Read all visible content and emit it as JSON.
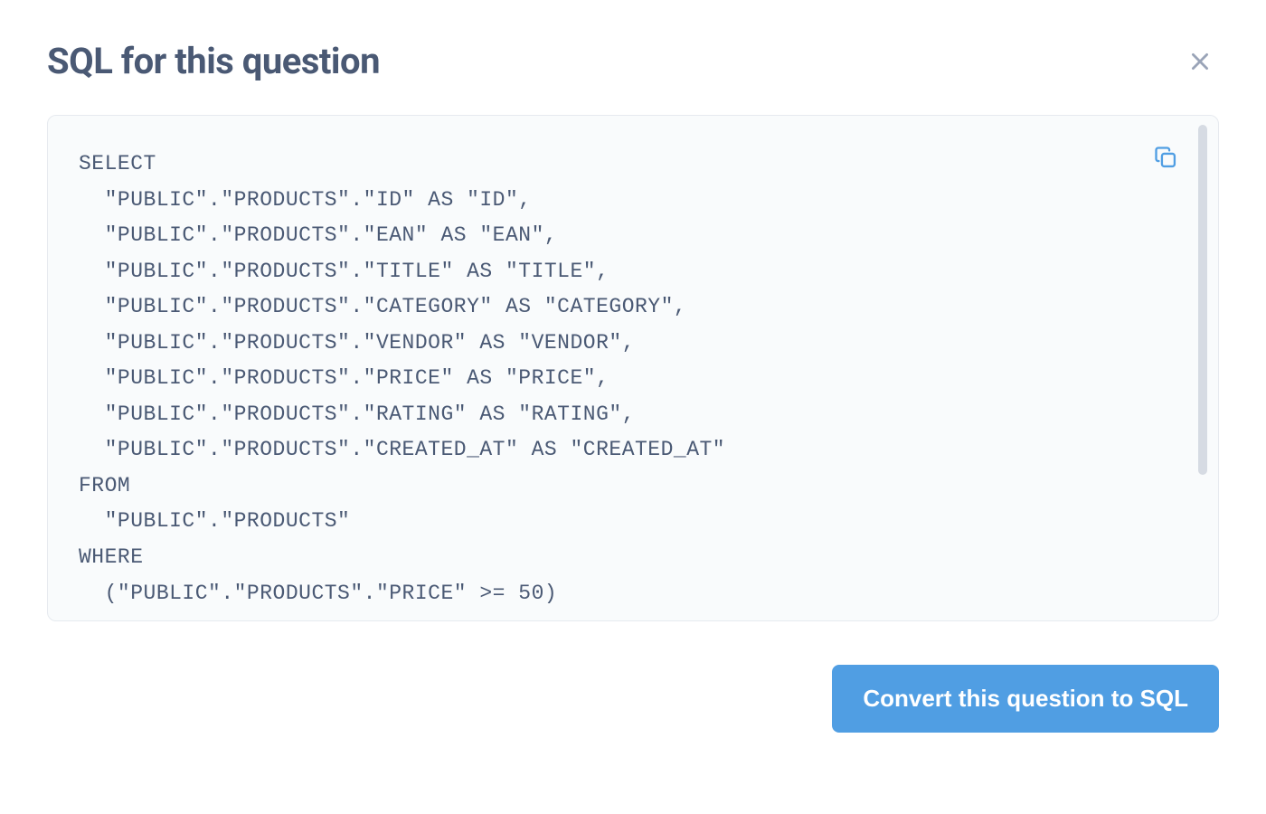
{
  "modal": {
    "title": "SQL for this question",
    "close_label": "Close",
    "copy_label": "Copy",
    "sql": "SELECT\n  \"PUBLIC\".\"PRODUCTS\".\"ID\" AS \"ID\",\n  \"PUBLIC\".\"PRODUCTS\".\"EAN\" AS \"EAN\",\n  \"PUBLIC\".\"PRODUCTS\".\"TITLE\" AS \"TITLE\",\n  \"PUBLIC\".\"PRODUCTS\".\"CATEGORY\" AS \"CATEGORY\",\n  \"PUBLIC\".\"PRODUCTS\".\"VENDOR\" AS \"VENDOR\",\n  \"PUBLIC\".\"PRODUCTS\".\"PRICE\" AS \"PRICE\",\n  \"PUBLIC\".\"PRODUCTS\".\"RATING\" AS \"RATING\",\n  \"PUBLIC\".\"PRODUCTS\".\"CREATED_AT\" AS \"CREATED_AT\"\nFROM\n  \"PUBLIC\".\"PRODUCTS\"\nWHERE\n  (\"PUBLIC\".\"PRODUCTS\".\"PRICE\" >= 50)",
    "convert_label": "Convert this question to SQL"
  }
}
